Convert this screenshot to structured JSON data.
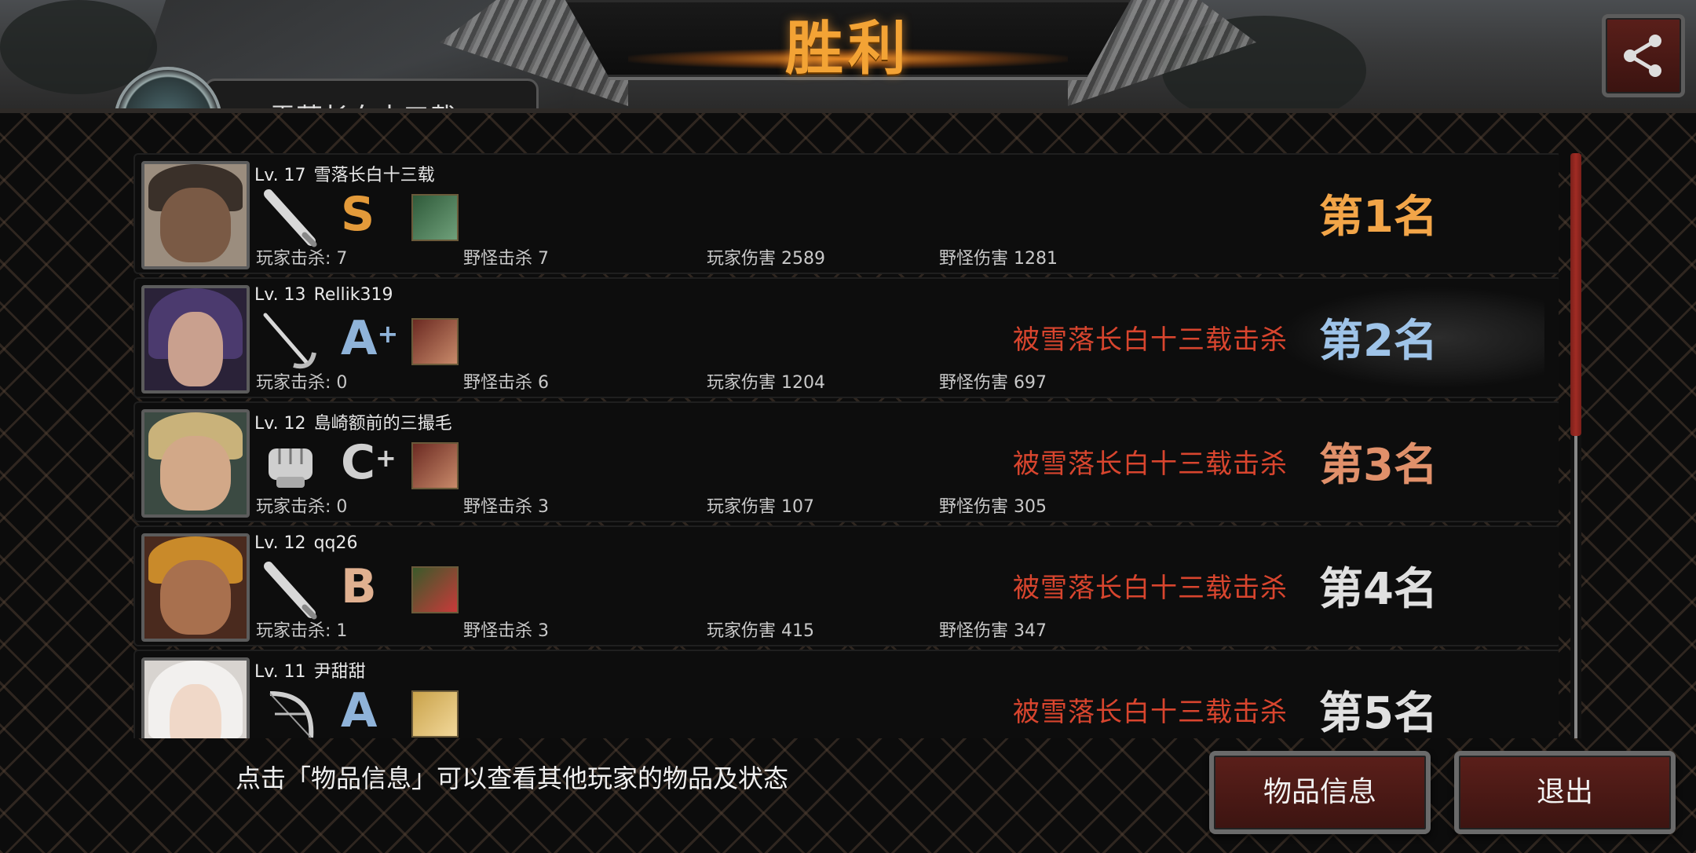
{
  "header": {
    "title": "胜利",
    "player_tab_name": "雪落长白十三载"
  },
  "share": {
    "icon": "share-icon"
  },
  "players": [
    {
      "level": "Lv. 17",
      "name": "雪落长白十三载",
      "weapon_icon": "bat-icon",
      "grade": "S",
      "grade_plus": "",
      "grade_color": "#e39a3a",
      "player_kills": "玩家击杀: 7",
      "monster_kills": "野怪击杀 7",
      "player_damage": "玩家伤害 2589",
      "monster_damage": "野怪伤害 1281",
      "killed_by": "",
      "rank": "第1名",
      "rank_color": "#f2a548"
    },
    {
      "level": "Lv. 13",
      "name": "Rellik319",
      "weapon_icon": "rapier-icon",
      "grade": "A",
      "grade_plus": "+",
      "grade_color": "#8fb3d9",
      "player_kills": "玩家击杀: 0",
      "monster_kills": "野怪击杀 6",
      "player_damage": "玩家伤害 1204",
      "monster_damage": "野怪伤害 697",
      "killed_by": "被雪落长白十三载击杀",
      "rank": "第2名",
      "rank_color": "#9ec3e8"
    },
    {
      "level": "Lv. 12",
      "name": "島崎额前的三撮毛",
      "weapon_icon": "fist-icon",
      "grade": "C",
      "grade_plus": "+",
      "grade_color": "#cfcfcf",
      "player_kills": "玩家击杀: 0",
      "monster_kills": "野怪击杀 3",
      "player_damage": "玩家伤害 107",
      "monster_damage": "野怪伤害 305",
      "killed_by": "被雪落长白十三载击杀",
      "rank": "第3名",
      "rank_color": "#e0906a"
    },
    {
      "level": "Lv. 12",
      "name": "qq26",
      "weapon_icon": "bat-icon",
      "grade": "B",
      "grade_plus": "",
      "grade_color": "#e0b090",
      "player_kills": "玩家击杀: 1",
      "monster_kills": "野怪击杀 3",
      "player_damage": "玩家伤害 415",
      "monster_damage": "野怪伤害 347",
      "killed_by": "被雪落长白十三载击杀",
      "rank": "第4名",
      "rank_color": "#e0e0e0"
    },
    {
      "level": "Lv. 11",
      "name": "尹甜甜",
      "weapon_icon": "bow-icon",
      "grade": "A",
      "grade_plus": "",
      "grade_color": "#8fb3d9",
      "player_kills": "",
      "monster_kills": "",
      "player_damage": "",
      "monster_damage": "",
      "killed_by": "被雪落长白十三载击杀",
      "rank": "第5名",
      "rank_color": "#e0e0e0"
    }
  ],
  "footer": {
    "hint": "点击「物品信息」可以查看其他玩家的物品及状态",
    "items_button": "物品信息",
    "exit_button": "退出"
  },
  "colors": {
    "title": "#f3a335",
    "killed_by": "#d8452e",
    "button_bg": "#4a1915"
  }
}
